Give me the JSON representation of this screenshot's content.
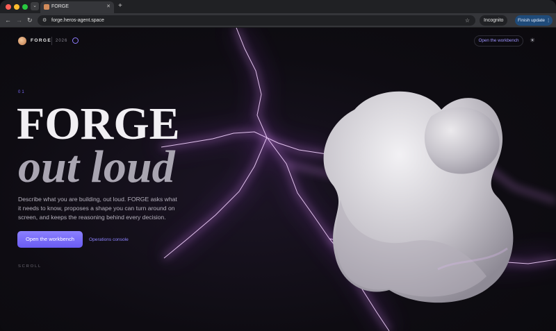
{
  "browser": {
    "tab": {
      "title": "FORGE",
      "close": "✕"
    },
    "new_tab": "+",
    "tab_search": "⌄",
    "nav": {
      "back": "←",
      "forward": "→",
      "reload": "↻"
    },
    "url": "forge.heros-agent.space",
    "site_icon": "⚙",
    "star": "☆",
    "incognito_label": "Incognito",
    "update_label": "Finish update ⋮"
  },
  "site": {
    "brand": "FORGE",
    "year": "2026",
    "nav_cta": "Open the workbench",
    "theme_icon": "☀"
  },
  "hero": {
    "section_number": "01",
    "title_line1": "FORGE",
    "title_line2": "out loud",
    "lead": "Describe what you are building, out loud. FORGE asks what it needs to know, proposes a shape you can turn around on screen, and keeps the reasoning behind every decision.",
    "primary_cta": "Open the workbench",
    "secondary_cta": "Operations console",
    "scroll_hint": "SCROLL"
  },
  "colors": {
    "accent": "#7c6cff",
    "button": "#6a5cf2",
    "background": "#0b0a0e",
    "lightning": "#c47ae6"
  }
}
